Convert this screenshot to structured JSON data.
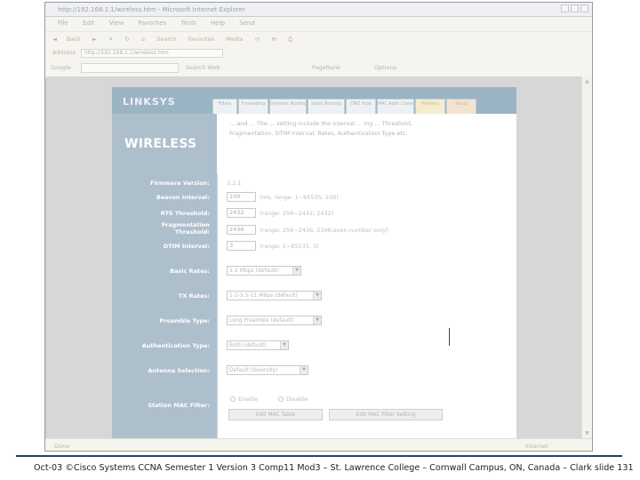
{
  "window": {
    "title": "http://192.168.1.1/wireless.htm - Microsoft Internet Explorer",
    "menu": [
      "File",
      "Edit",
      "View",
      "Favorites",
      "Tools",
      "Help"
    ],
    "menu_extra": "Send"
  },
  "toolbar": {
    "back": "Back",
    "search": "Search",
    "favorites": "Favorites",
    "media": "Media"
  },
  "address": {
    "label": "Address",
    "value": "http://192.168.1.1/wireless.htm"
  },
  "googlebar": {
    "logo": "Google",
    "search_web": "Search Web",
    "pagerank": "PageRank",
    "options": "Options"
  },
  "statusbar": {
    "left": "Done",
    "zone": "Internet"
  },
  "router": {
    "logo": "LINKSYS",
    "tabs": [
      {
        "label": "Filters"
      },
      {
        "label": "Forwarding"
      },
      {
        "label": "Dynamic Routing"
      },
      {
        "label": "Static Routing"
      },
      {
        "label": "DMZ Host"
      },
      {
        "label": "MAC Addr. Clone"
      },
      {
        "label": "Wireless"
      },
      {
        "label": "Setup"
      }
    ],
    "section_title": "WIRELESS",
    "intro_line1": "... and ... The ... setting include the Interval ... ing ... Threshold,",
    "intro_line2": "Fragmentation, DTIM Interval, Rates, Authentication Type etc."
  },
  "form": {
    "firmware": {
      "label": "Firmware Version:",
      "value": "1.2.1"
    },
    "beacon": {
      "label": "Beacon Interval:",
      "value": "100",
      "hint": "(ms, range: 1~65535, 100)"
    },
    "rts": {
      "label": "RTS Threshold:",
      "value": "2432",
      "hint": "(range: 256~2432, 2432)"
    },
    "frag": {
      "label": "Fragmentation Threshold:",
      "value": "2436",
      "hint": "(range: 256~2436, 2346,even number only)"
    },
    "dtim": {
      "label": "DTIM Interval:",
      "value": "3",
      "hint": "(range: 1~65535, 3)"
    },
    "basic_rates": {
      "label": "Basic Rates:",
      "value": "1-2 Mbps (default)"
    },
    "tx_rates": {
      "label": "TX Rates:",
      "value": "1-2-5.5-11 Mbps (default)"
    },
    "preamble": {
      "label": "Preamble Type:",
      "value": "Long Preamble (default)"
    },
    "auth": {
      "label": "Authentication Type:",
      "value": "Both (default)"
    },
    "antenna": {
      "label": "Antenna Selection:",
      "value": "Default (diversity)"
    },
    "mac_filter": {
      "label": "Station MAC Filter:",
      "enable": "Enable",
      "disable": "Disable",
      "edit_table": "Edit MAC Table",
      "edit_setting": "Edit MAC Filter Setting"
    }
  },
  "footer": "Oct-03 ©Cisco Systems CCNA Semester 1 Version 3 Comp11 Mod3 – St. Lawrence College – Cornwall Campus, ON, Canada – Clark slide 131"
}
